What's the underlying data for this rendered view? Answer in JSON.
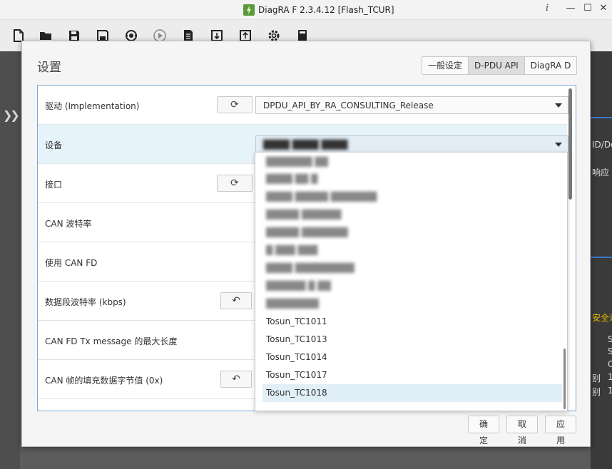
{
  "window": {
    "title": "DiagRA F 2.3.4.12 [Flash_TCUR]",
    "info_glyph": "i",
    "minimize_glyph": "—",
    "maximize_glyph": "☐",
    "close_glyph": "✕"
  },
  "toolbar": {
    "icons": [
      "new-file-icon",
      "open-folder-icon",
      "save-icon",
      "save-as-icon",
      "connect-icon",
      "play-icon",
      "document-icon",
      "flash-write-icon",
      "flash-read-icon",
      "settings-gear-icon",
      "book-icon"
    ]
  },
  "sidebar": {
    "expand_glyph": "❯❯"
  },
  "background": {
    "col_header": "ID/Do",
    "response": "响应",
    "security_access": "安全访",
    "right_letters": [
      "S",
      "S",
      "C"
    ],
    "row_labels": [
      "别",
      "别"
    ],
    "row_values": [
      "1",
      "1"
    ]
  },
  "dialog": {
    "title": "设置",
    "tabs": [
      "一般设定",
      "D-PDU API",
      "DiagRA D"
    ],
    "active_tab": "D-PDU API",
    "rows": [
      {
        "label": "驱动 (Implementation)",
        "value": "DPDU_API_BY_RA_CONSULTING_Release"
      },
      {
        "label": "设备",
        "value": "████ ████ ████"
      },
      {
        "label": "接口"
      },
      {
        "label": "CAN 波特率"
      },
      {
        "label": "使用 CAN FD"
      },
      {
        "label": "数据段波特率 (kbps)"
      },
      {
        "label": "CAN FD Tx message 的最大长度"
      },
      {
        "label": "CAN 帧的填充数据字节值 (0x)"
      }
    ],
    "refresh_glyph": "⟳",
    "reset_glyph": "↶",
    "dropdown_items": [
      {
        "label": "███████ ██",
        "blurred": true
      },
      {
        "label": "████ ██ █",
        "blurred": true
      },
      {
        "label": "████ █████ ███████",
        "blurred": true
      },
      {
        "label": "█████ ██████",
        "blurred": true
      },
      {
        "label": "█████ ███████",
        "blurred": true
      },
      {
        "label": "█ ███ ███",
        "blurred": true
      },
      {
        "label": "████ █████████",
        "blurred": true
      },
      {
        "label": "██████ █ ██",
        "blurred": true
      },
      {
        "label": "████████",
        "blurred": true
      },
      {
        "label": "Tosun_TC1011",
        "blurred": false
      },
      {
        "label": "Tosun_TC1013",
        "blurred": false
      },
      {
        "label": "Tosun_TC1014",
        "blurred": false
      },
      {
        "label": "Tosun_TC1017",
        "blurred": false
      },
      {
        "label": "Tosun_TC1018",
        "blurred": false,
        "selected": true
      }
    ],
    "buttons": {
      "ok": "确定",
      "cancel": "取消",
      "apply": "应用"
    }
  },
  "colors": {
    "form_border": "#7aa7d6",
    "highlight_row": "#e7f3fa",
    "selected_item": "#e1eff8"
  }
}
